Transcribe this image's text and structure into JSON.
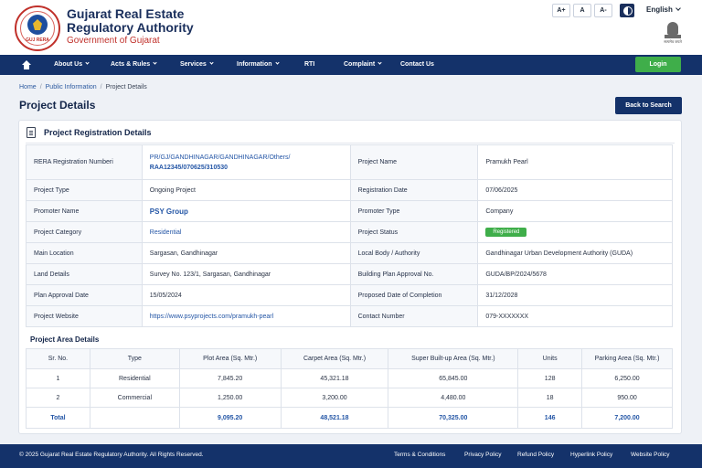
{
  "header": {
    "logo_text": "GUJ RERA",
    "title_line1": "Gujarat Real Estate",
    "title_line2": "Regulatory Authority",
    "subtitle": "Government of Gujarat",
    "font_controls": [
      "A+",
      "A",
      "A-"
    ],
    "language": "English",
    "emblem_caption": "सत्यमेव जयते"
  },
  "nav": {
    "items": [
      {
        "label": "About Us",
        "dropdown": true
      },
      {
        "label": "Acts & Rules",
        "dropdown": true
      },
      {
        "label": "Services",
        "dropdown": true
      },
      {
        "label": "Information",
        "dropdown": true
      },
      {
        "label": "RTI",
        "dropdown": false
      },
      {
        "label": "Complaint",
        "dropdown": true
      },
      {
        "label": "Contact Us",
        "dropdown": false
      }
    ],
    "login": "Login"
  },
  "breadcrumb": [
    "Home",
    "Public Information",
    "Project Details"
  ],
  "page": {
    "title": "Project Details",
    "back_button": "Back to Search"
  },
  "registration": {
    "section_title": "Project Registration Details",
    "rows": [
      [
        {
          "label": "RERA Registration Numberi",
          "value": "PR/GJ/GANDHINAGAR/GANDHINAGAR/Others/",
          "value2": "RAA12345/070625/310530"
        },
        {
          "label": "Project Name",
          "value": "Pramukh Pearl"
        }
      ],
      [
        {
          "label": "Project Type",
          "value": "Ongoing Project"
        },
        {
          "label": "Registration Date",
          "value": "07/06/2025"
        }
      ],
      [
        {
          "label": "Promoter Name",
          "value": "PSY Group"
        },
        {
          "label": "Promoter Type",
          "value": "Company"
        }
      ],
      [
        {
          "label": "Project Category",
          "value": "Residential"
        },
        {
          "label": "Project Status",
          "value": "Registered"
        }
      ],
      [
        {
          "label": "Main Location",
          "value": "Sargasan, Gandhinagar"
        },
        {
          "label": "Local Body / Authority",
          "value": "Gandhinagar Urban Development Authority (GUDA)"
        }
      ],
      [
        {
          "label": "Land Details",
          "value": "Survey No. 123/1, Sargasan, Gandhinagar"
        },
        {
          "label": "Building Plan Approval No.",
          "value": "GUDA/BP/2024/5678"
        }
      ],
      [
        {
          "label": "Plan Approval Date",
          "value": "15/05/2024"
        },
        {
          "label": "Proposed Date of Completion",
          "value": "31/12/2028"
        }
      ],
      [
        {
          "label": "Project Website",
          "value": "https://www.psyprojects.com/pramukh-pearl"
        },
        {
          "label": "Contact Number",
          "value": "079-XXXXXXX"
        }
      ]
    ]
  },
  "area": {
    "title": "Project Area Details",
    "headers": [
      "Sr. No.",
      "Type",
      "Plot Area (Sq. Mtr.)",
      "Carpet Area (Sq. Mtr.)",
      "Super Built-up Area (Sq. Mtr.)",
      "Units",
      "Parking Area (Sq. Mtr.)"
    ],
    "rows": [
      [
        "1",
        "Residential",
        "7,845.20",
        "45,321.18",
        "65,845.00",
        "128",
        "6,250.00"
      ],
      [
        "2",
        "Commercial",
        "1,250.00",
        "3,200.00",
        "4,480.00",
        "18",
        "950.00"
      ]
    ],
    "total": [
      "Total",
      "",
      "9,095.20",
      "48,521.18",
      "70,325.00",
      "146",
      "7,200.00"
    ]
  },
  "footer": {
    "copyright": "© 2025 Gujarat Real Estate Regulatory Authority. All Rights Reserved.",
    "links": [
      "Terms & Conditions",
      "Privacy Policy",
      "Refund Policy",
      "Hyperlink Policy",
      "Website Policy"
    ]
  },
  "colors": {
    "primary": "#14326a",
    "accent_red": "#c0302a",
    "success": "#3fae4a",
    "link": "#2456a6"
  }
}
